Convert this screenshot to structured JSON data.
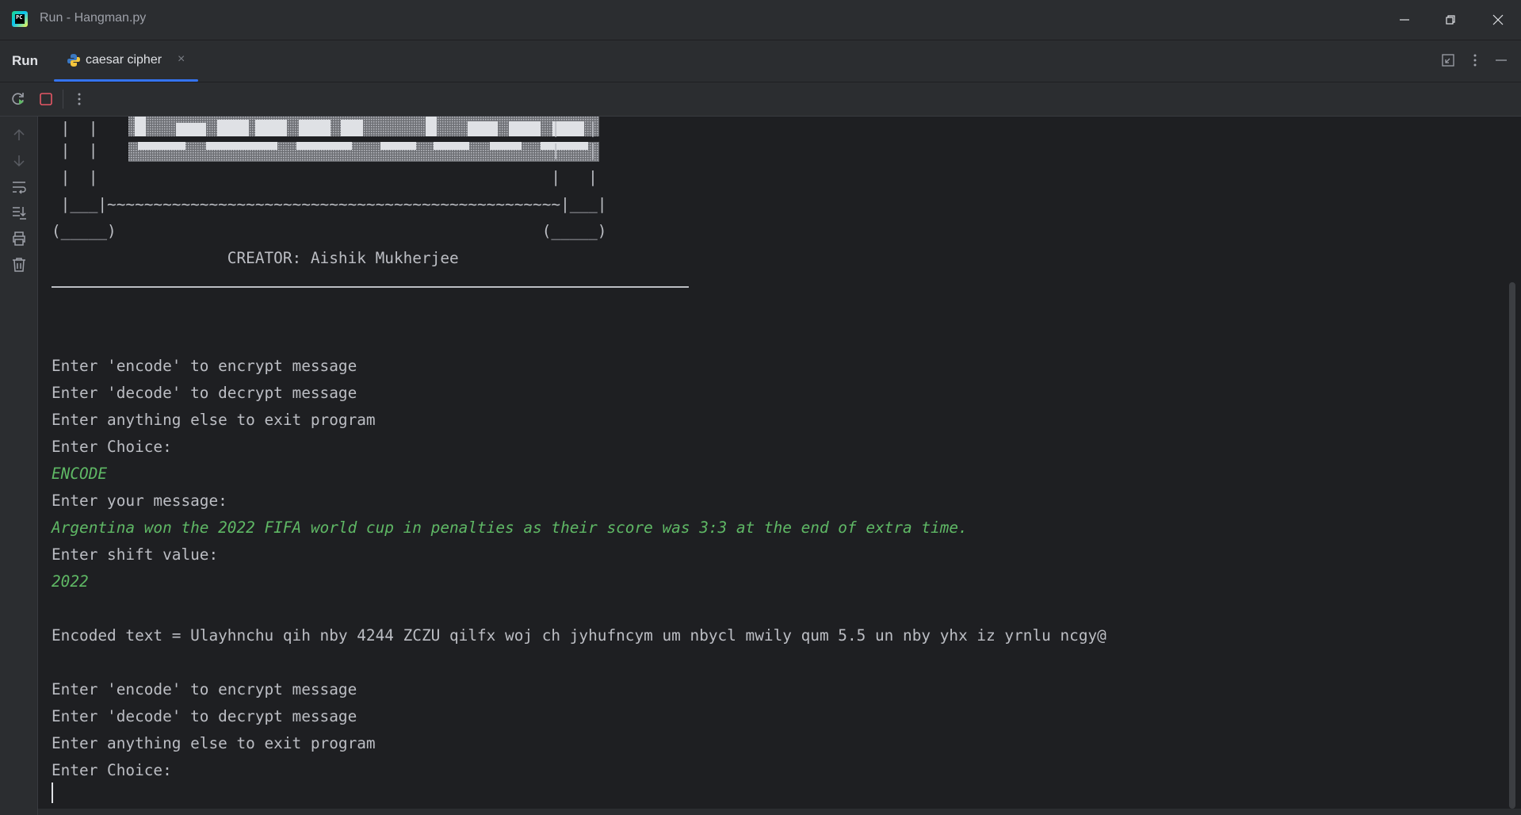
{
  "window": {
    "title": "Run - Hangman.py"
  },
  "tabbar": {
    "panel_label": "Run",
    "tab_label": "caesar cipher",
    "tab_close": "×"
  },
  "console": {
    "ascii_lines": [
      " |  |                                                 |   |",
      " |  |                                                 |   |",
      " |  |                                                 |   |",
      " |___|~~~~~~~~~~~~~~~~~~~~~~~~~~~~~~~~~~~~~~~~~~~~~~~~~|___|",
      "(_____)                                              (_____)",
      "                   CREATOR: Aishik Mukherjee"
    ],
    "lines": [
      {
        "text": "Enter 'encode' to encrypt message",
        "kind": "output"
      },
      {
        "text": "Enter 'decode' to decrypt message",
        "kind": "output"
      },
      {
        "text": "Enter anything else to exit program",
        "kind": "output"
      },
      {
        "text": "Enter Choice:",
        "kind": "output"
      },
      {
        "text": "ENCODE",
        "kind": "input"
      },
      {
        "text": "Enter your message:",
        "kind": "output"
      },
      {
        "text": "Argentina won the 2022 FIFA world cup in penalties as their score was 3:3 at the end of extra time.",
        "kind": "input"
      },
      {
        "text": "Enter shift value:",
        "kind": "output"
      },
      {
        "text": "2022",
        "kind": "input"
      },
      {
        "text": "Encoded text = Ulayhnchu qih nby 4244 ZCZU qilfx woj ch jyhufncym um nbycl mwily qum 5.5 un nby yhx iz yrnlu ncgy@",
        "kind": "output"
      },
      {
        "text": "Enter 'encode' to encrypt message",
        "kind": "output"
      },
      {
        "text": "Enter 'decode' to decrypt message",
        "kind": "output"
      },
      {
        "text": "Enter anything else to exit program",
        "kind": "output"
      },
      {
        "text": "Enter Choice:",
        "kind": "output"
      }
    ],
    "colors": {
      "background": "#1e1f22",
      "output_text": "#bcbec4",
      "input_text": "#5fb865"
    }
  }
}
